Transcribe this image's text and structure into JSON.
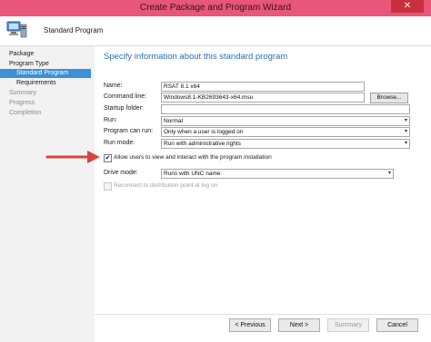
{
  "window": {
    "title": "Create Package and Program Wizard",
    "close_glyph": "✕"
  },
  "header": {
    "page_name": "Standard Program",
    "icon": "computer-wizard-icon"
  },
  "nav": {
    "items": [
      {
        "label": "Package",
        "state": "normal"
      },
      {
        "label": "Program Type",
        "state": "normal"
      },
      {
        "label": "Standard Program",
        "state": "selected"
      },
      {
        "label": "Requirements",
        "state": "normal"
      },
      {
        "label": "Summary",
        "state": "muted"
      },
      {
        "label": "Progress",
        "state": "muted"
      },
      {
        "label": "Completion",
        "state": "muted"
      }
    ]
  },
  "main": {
    "heading": "Specify information about this standard program",
    "name_label": "Name:",
    "name_value": "RSAT 8.1 x64",
    "command_label": "Command line:",
    "command_value": "Windows8.1-KB2693643-x64.msu",
    "browse_label": "Browse...",
    "startup_label": "Startup folder:",
    "startup_value": "",
    "run_label": "Run:",
    "run_value": "Normal",
    "can_run_label": "Program can run:",
    "can_run_value": "Only when a user is logged on",
    "run_mode_label": "Run mode:",
    "run_mode_value": "Run with administrative rights",
    "allow_interact_label": "Allow users to view and interact with the program installation",
    "allow_interact_checked": true,
    "check_glyph": "✔",
    "drive_mode_label": "Drive mode:",
    "drive_mode_value": "Runs with UNC name",
    "reconnect_label": "Reconnect to distribution point at log on",
    "reconnect_checked": false,
    "combo_arrow": "▾"
  },
  "footer": {
    "previous": "< Previous",
    "next": "Next >",
    "summary": "Summary",
    "cancel": "Cancel"
  },
  "colors": {
    "titlebar": "#e8567a",
    "selected_nav": "#3d8fd6",
    "heading": "#2a6ebb",
    "annotation_arrow": "#d9443a"
  }
}
